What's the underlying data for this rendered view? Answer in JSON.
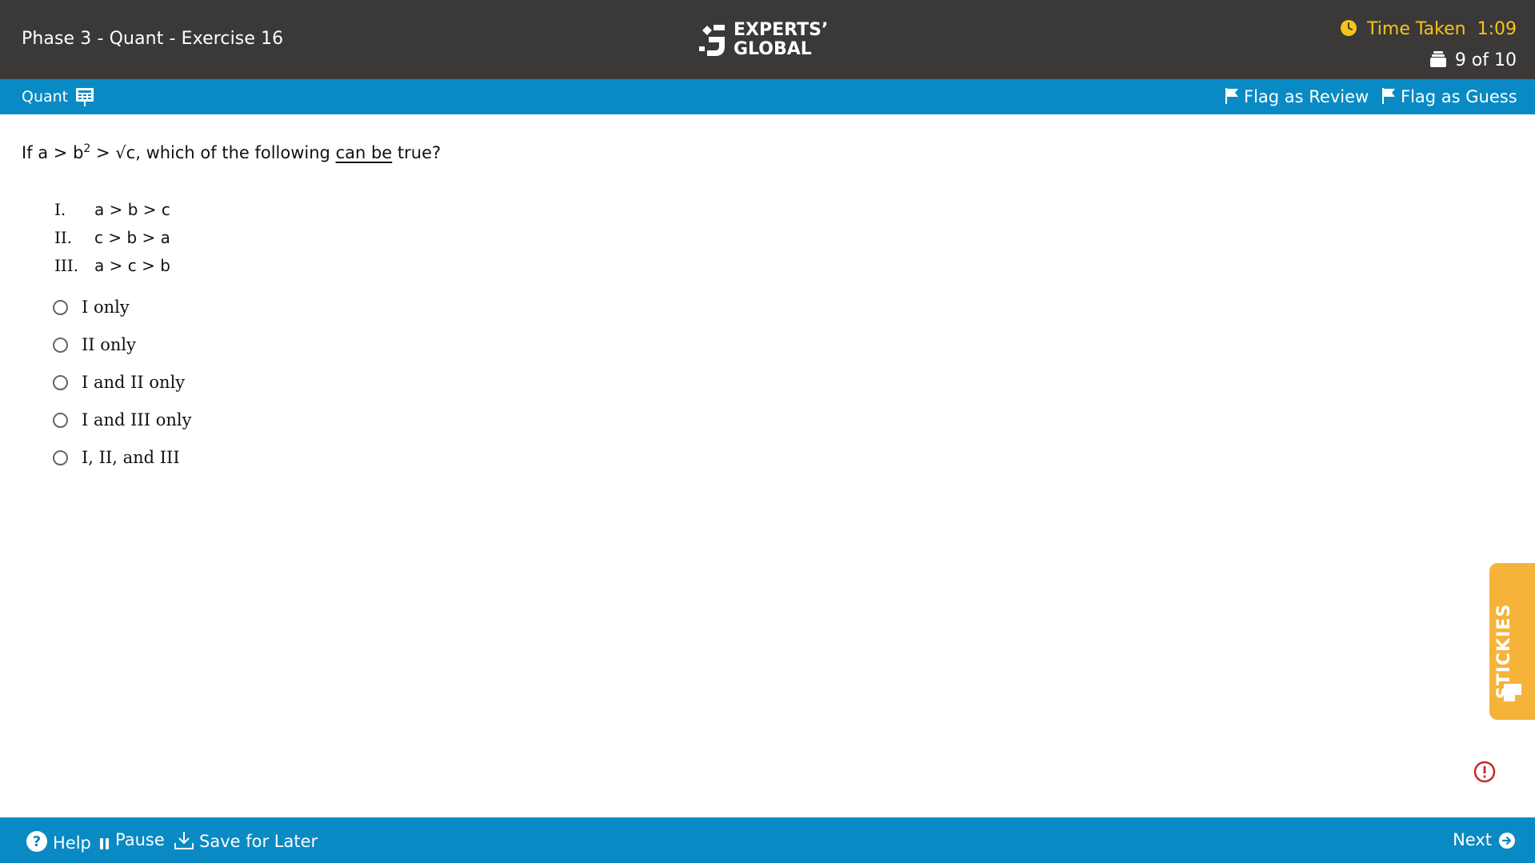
{
  "header": {
    "exercise_title": "Phase 3 - Quant - Exercise 16",
    "logo_line1": "EXPERTS’",
    "logo_line2": "GLOBAL",
    "timer_label": "Time Taken",
    "timer_value": "1:09",
    "question_counter": "9 of 10"
  },
  "subbar": {
    "section": "Quant",
    "flag_review_label": "Flag as Review",
    "flag_guess_label": "Flag as Guess"
  },
  "question": {
    "prefix": "If a > b",
    "superscript": "2",
    "middle": " > √c, which of the following ",
    "emphasis": "can be",
    "suffix": " true?",
    "statements": [
      {
        "num": "I.",
        "expr": "a > b > c"
      },
      {
        "num": "II.",
        "expr": "c > b > a"
      },
      {
        "num": "III.",
        "expr": "a > c > b"
      }
    ],
    "options": [
      "I only",
      "II only",
      "I and II only",
      "I and III only",
      "I, II, and III"
    ]
  },
  "stickies_label": "STICKIES",
  "footer": {
    "help_label": "Help",
    "pause_label": "Pause",
    "save_label": "Save for Later",
    "next_label": "Next"
  },
  "colors": {
    "header_bg": "#3b3838",
    "accent_blue": "#0a8ac4",
    "timer_yellow": "#f5c518",
    "stickies_orange": "#f6b33a",
    "warning_red": "#c62828"
  },
  "icons": [
    "calculator-icon",
    "flag-icon",
    "clock-icon",
    "question-stack-icon",
    "help-icon",
    "pause-icon",
    "download-icon",
    "arrow-right-circle-icon",
    "sticky-note-icon",
    "warning-icon"
  ]
}
